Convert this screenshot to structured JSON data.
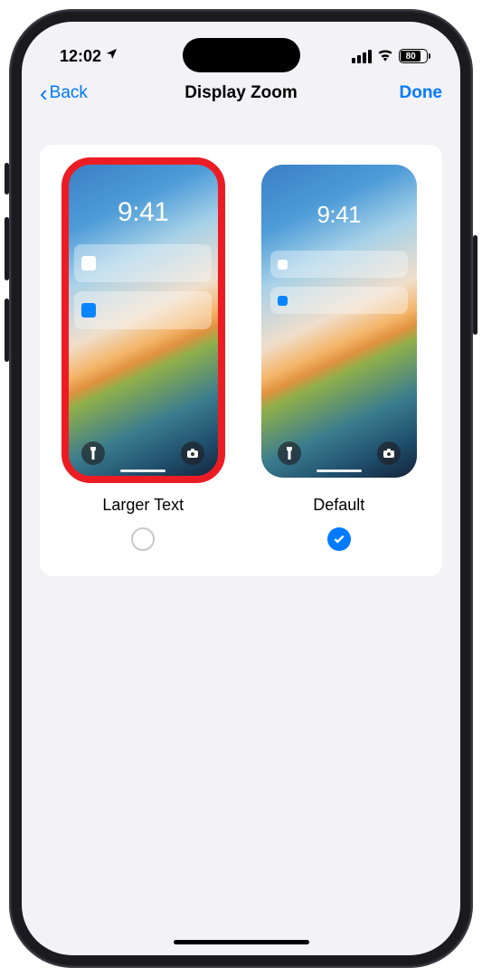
{
  "status": {
    "time": "12:02",
    "battery_percent": "80"
  },
  "nav": {
    "back_label": "Back",
    "title": "Display Zoom",
    "done_label": "Done"
  },
  "preview": {
    "lock_time": "9:41"
  },
  "options": {
    "larger": {
      "label": "Larger Text",
      "selected": false,
      "highlighted": true
    },
    "default": {
      "label": "Default",
      "selected": true,
      "highlighted": false
    }
  }
}
